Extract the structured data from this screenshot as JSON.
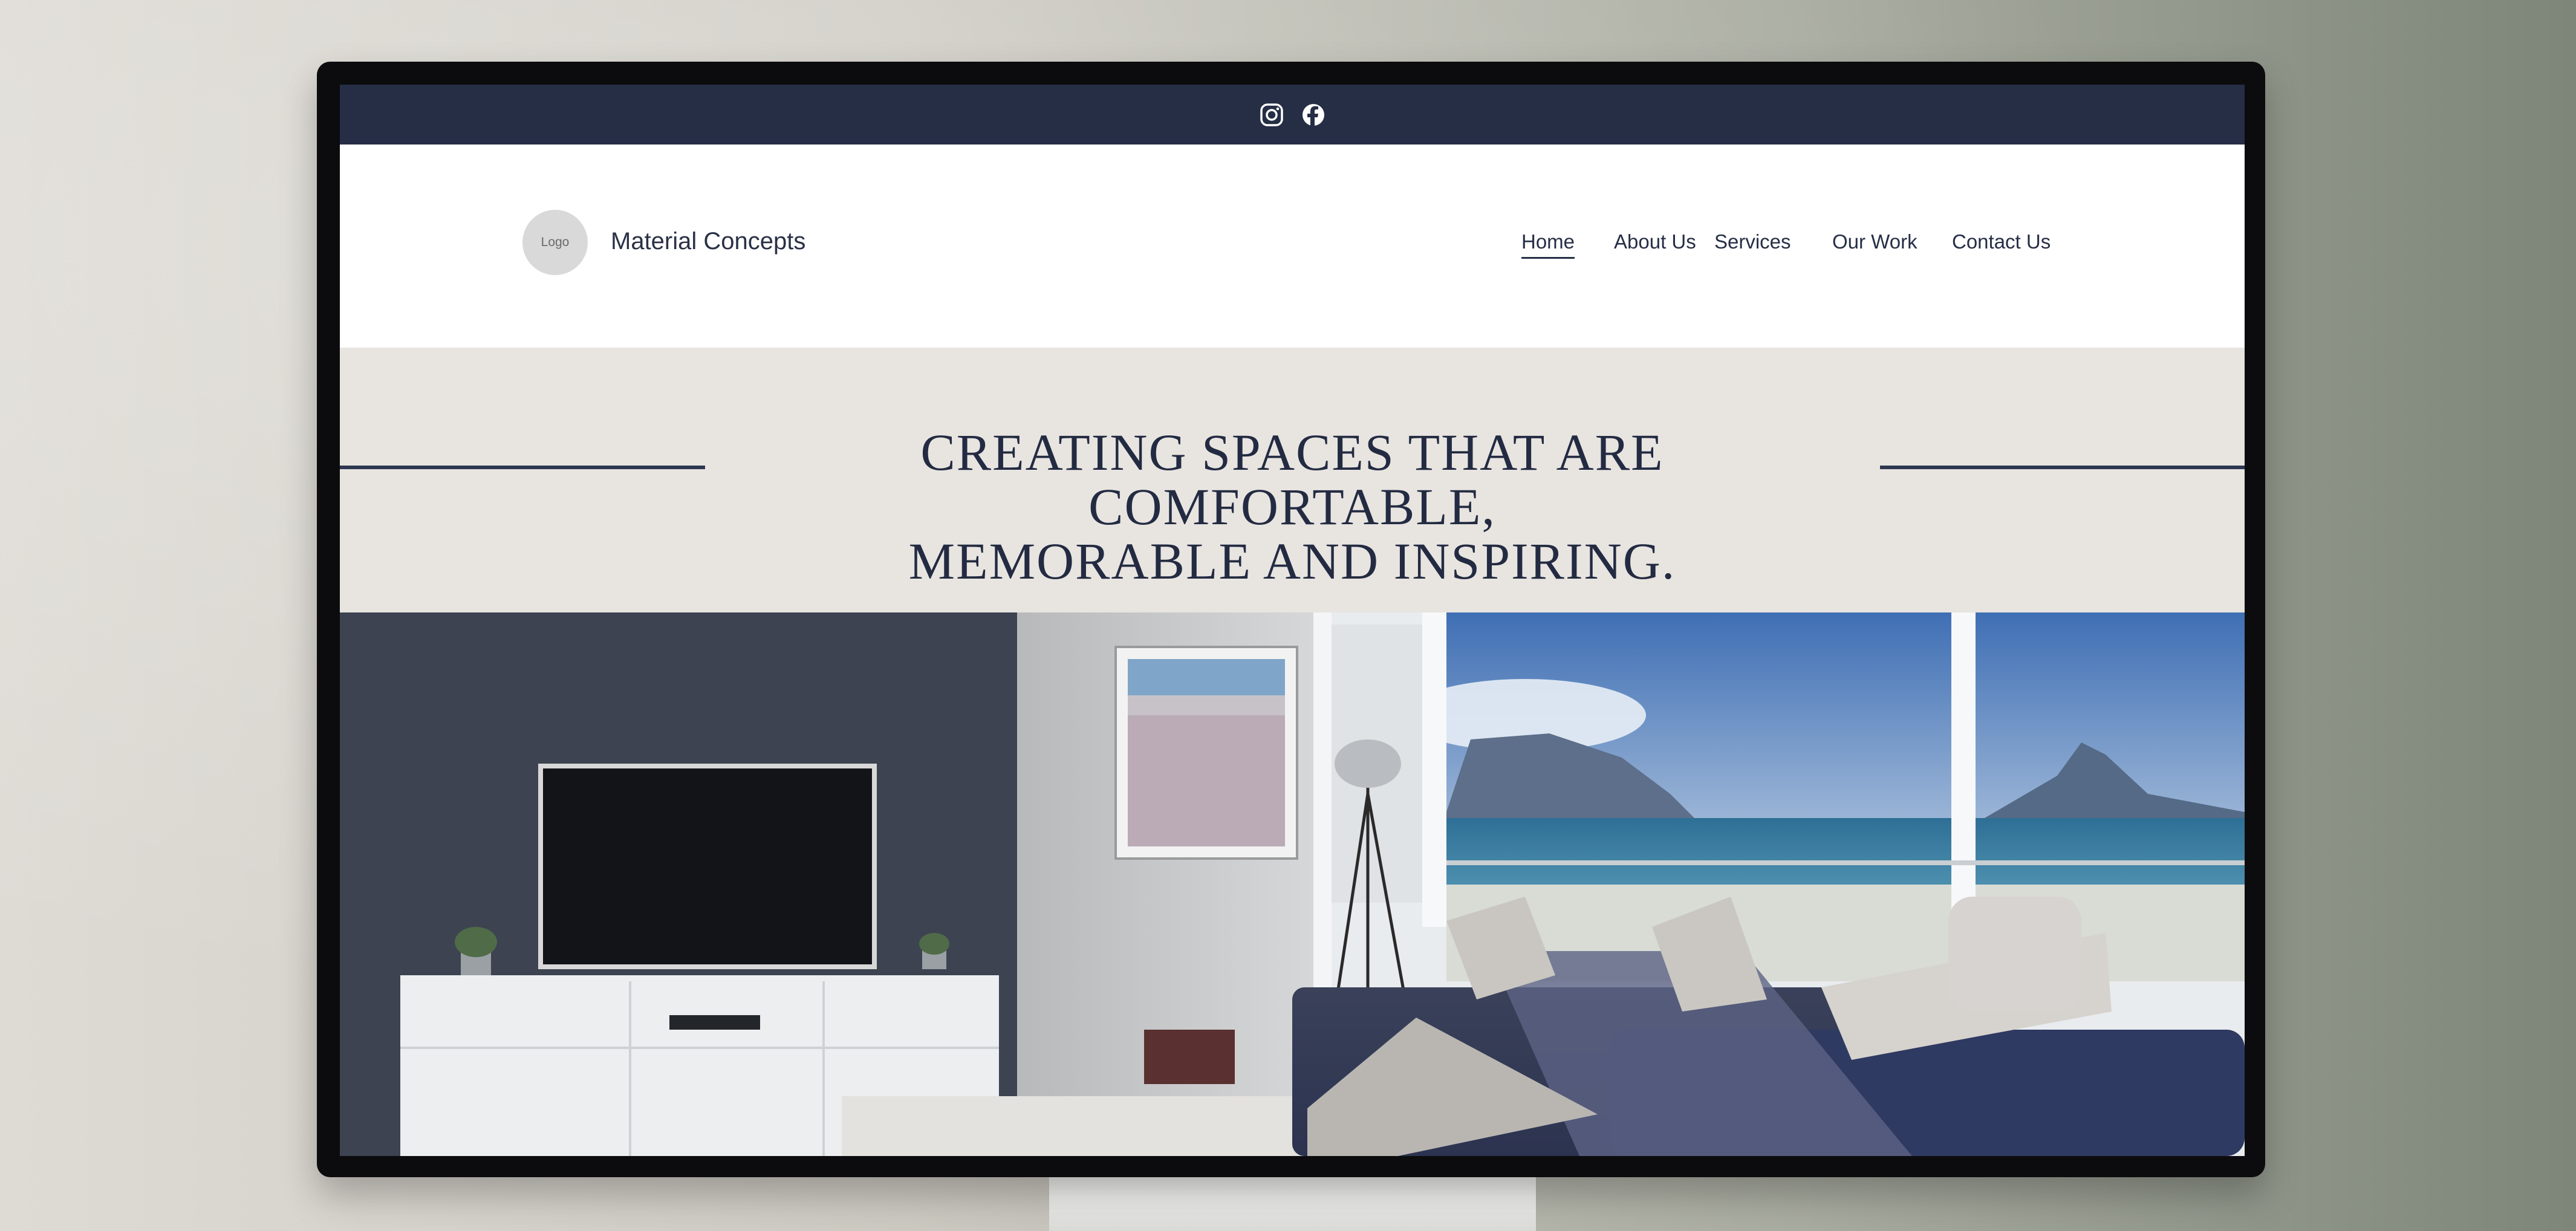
{
  "social": {
    "icons": [
      "instagram-icon",
      "facebook-icon"
    ]
  },
  "header": {
    "logo_text": "Logo",
    "brand_name": "Material Concepts",
    "nav": [
      {
        "label": "Home",
        "active": true
      },
      {
        "label": "About Us",
        "active": false
      },
      {
        "label": "Services",
        "active": false
      },
      {
        "label": "Our Work",
        "active": false
      },
      {
        "label": "Contact Us",
        "active": false
      }
    ]
  },
  "hero": {
    "tagline_line1": "Creating spaces that are comfortable,",
    "tagline_line2": "memorable and inspiring."
  },
  "colors": {
    "navy": "#252e45",
    "band": "#e8e4e0",
    "logo_gray": "#d9d9d9"
  }
}
